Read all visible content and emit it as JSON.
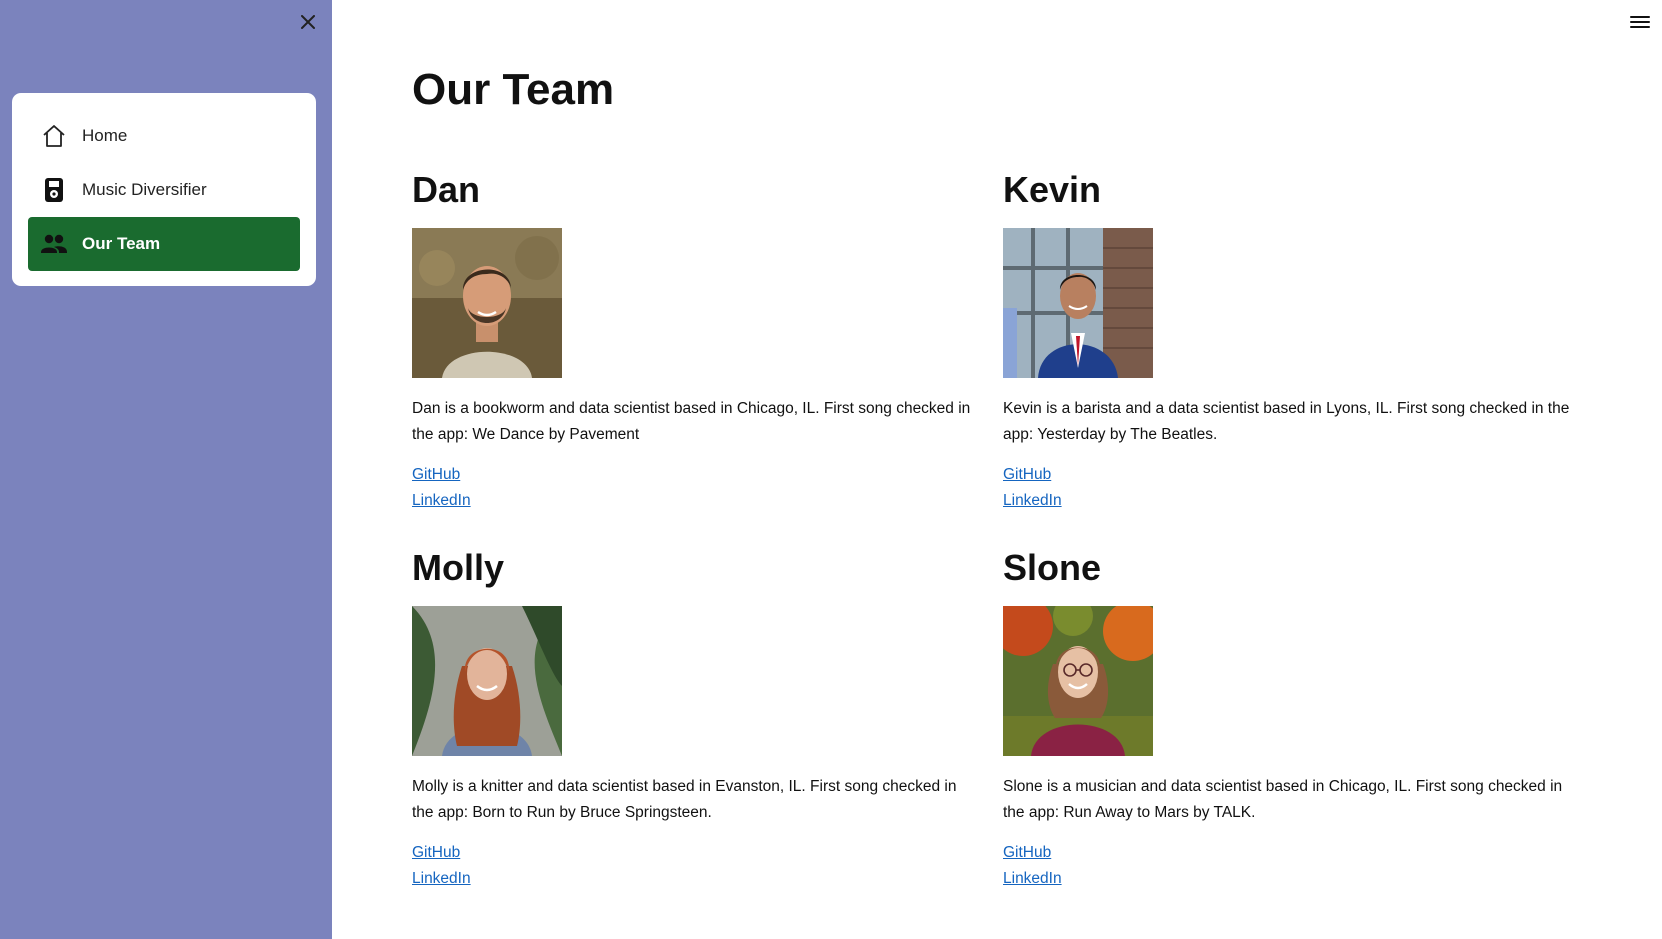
{
  "sidebar": {
    "close_icon": "close-icon",
    "nav": [
      {
        "label": "Home",
        "icon": "house-icon",
        "active": false
      },
      {
        "label": "Music Diversifier",
        "icon": "music-player-icon",
        "active": false
      },
      {
        "label": "Our Team",
        "icon": "people-icon",
        "active": true
      }
    ],
    "colors": {
      "background": "#7b83bd",
      "active": "#1a6b2f"
    }
  },
  "header": {
    "menu_icon": "hamburger-icon"
  },
  "main": {
    "title": "Our Team",
    "members": [
      {
        "name": "Dan",
        "bio": "Dan is a bookworm and data scientist based in Chicago, IL. First song checked in the app: We Dance by Pavement",
        "links": [
          "GitHub",
          "LinkedIn"
        ]
      },
      {
        "name": "Kevin",
        "bio": "Kevin is a barista and a data scientist based in Lyons, IL. First song checked in the app: Yesterday by The Beatles.",
        "links": [
          "GitHub",
          "LinkedIn"
        ]
      },
      {
        "name": "Molly",
        "bio": "Molly is a knitter and data scientist based in Evanston, IL. First song checked in the app: Born to Run by Bruce Springsteen.",
        "links": [
          "GitHub",
          "LinkedIn"
        ]
      },
      {
        "name": "Slone",
        "bio": "Slone is a musician and data scientist based in Chicago, IL. First song checked in the app: Run Away to Mars by TALK.",
        "links": [
          "GitHub",
          "LinkedIn"
        ]
      }
    ]
  }
}
